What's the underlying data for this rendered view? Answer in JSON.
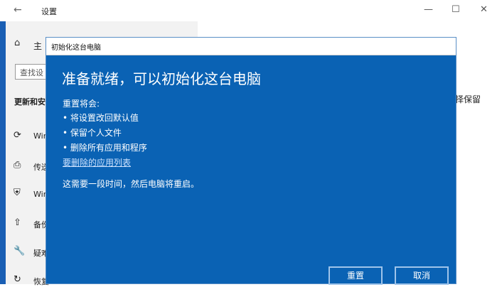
{
  "window": {
    "title": "设置",
    "back_icon": "back-arrow-icon",
    "minimize_glyph": "—",
    "maximize_glyph": "☐",
    "close_glyph": "✕"
  },
  "sidebar": {
    "home_label": "主",
    "search_placeholder": "查找设",
    "section_title": "更新和安",
    "items": [
      {
        "label": "Win",
        "icon": "sync-icon"
      },
      {
        "label": "传送",
        "icon": "delivery-icon"
      },
      {
        "label": "Win",
        "icon": "shield-icon"
      },
      {
        "label": "备份",
        "icon": "backup-icon"
      },
      {
        "label": "疑难",
        "icon": "wrench-icon"
      },
      {
        "label": "恢复",
        "icon": "recovery-icon"
      }
    ]
  },
  "right_text": "择保留",
  "dialog": {
    "title": "初始化这台电脑",
    "heading": "准备就绪，可以初始化这台电脑",
    "intro": "重置将会:",
    "bullets": [
      "将设置改回默认值",
      "保留个人文件",
      "删除所有应用和程序"
    ],
    "link": "要删除的应用列表",
    "note": "这需要一段时间，然后电脑将重启。",
    "reset_button": "重置",
    "cancel_button": "取消"
  },
  "colors": {
    "dialog_bg": "#0a62b4",
    "sidebar_accent": "#1a5fb4"
  }
}
